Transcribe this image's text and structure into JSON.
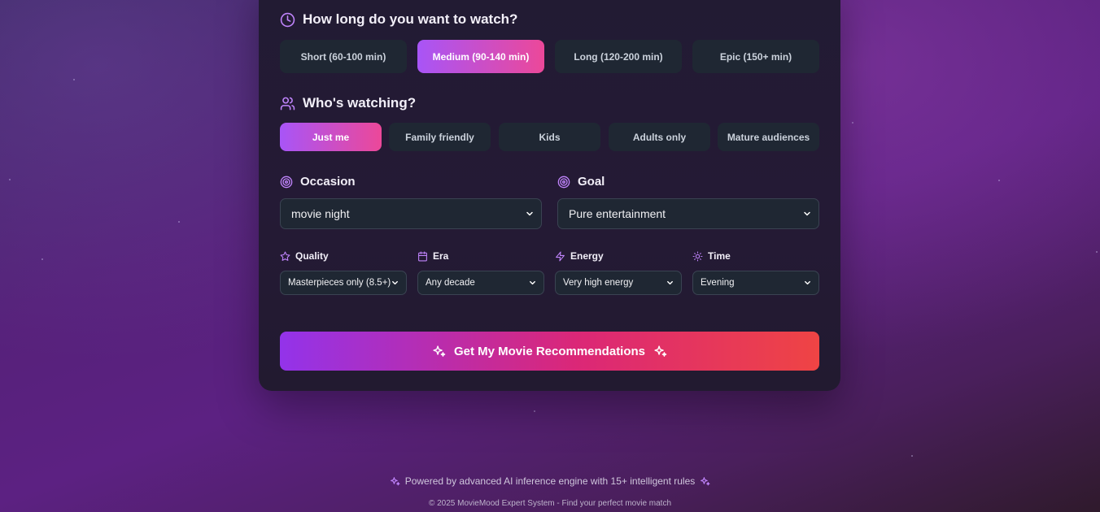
{
  "duration": {
    "title": "How long do you want to watch?",
    "icon": "clock-icon",
    "options": [
      {
        "label": "Short (60-100 min)",
        "active": false
      },
      {
        "label": "Medium (90-140 min)",
        "active": true
      },
      {
        "label": "Long (120-200 min)",
        "active": false
      },
      {
        "label": "Epic (150+ min)",
        "active": false
      }
    ]
  },
  "audience": {
    "title": "Who's watching?",
    "icon": "users-icon",
    "options": [
      {
        "label": "Just me",
        "active": true
      },
      {
        "label": "Family friendly",
        "active": false
      },
      {
        "label": "Kids",
        "active": false
      },
      {
        "label": "Adults only",
        "active": false
      },
      {
        "label": "Mature audiences",
        "active": false
      }
    ]
  },
  "occasion": {
    "label": "Occasion",
    "icon": "target-icon",
    "value": "movie night"
  },
  "goal": {
    "label": "Goal",
    "icon": "target-icon",
    "value": "Pure entertainment"
  },
  "filters": {
    "quality": {
      "label": "Quality",
      "icon": "star-icon",
      "value": "Masterpieces only (8.5+)"
    },
    "era": {
      "label": "Era",
      "icon": "calendar-icon",
      "value": "Any decade"
    },
    "energy": {
      "label": "Energy",
      "icon": "lightning-icon",
      "value": "Very high energy"
    },
    "time": {
      "label": "Time",
      "icon": "sun-icon",
      "value": "Evening"
    }
  },
  "cta": {
    "label": "Get My Movie Recommendations",
    "icon": "sparkles-icon"
  },
  "footer": {
    "powered": "Powered by advanced AI inference engine with 15+ intelligent rules",
    "copyright": "© 2025 MovieMood Expert System - Find your perfect movie match"
  },
  "colors": {
    "accent": "#c084fc",
    "active_gradient_start": "#a855f7",
    "active_gradient_end": "#ec4899",
    "cta_gradient_start": "#9333ea",
    "cta_gradient_end": "#ef4444",
    "panel": "#221b33",
    "control": "#1f2733"
  }
}
